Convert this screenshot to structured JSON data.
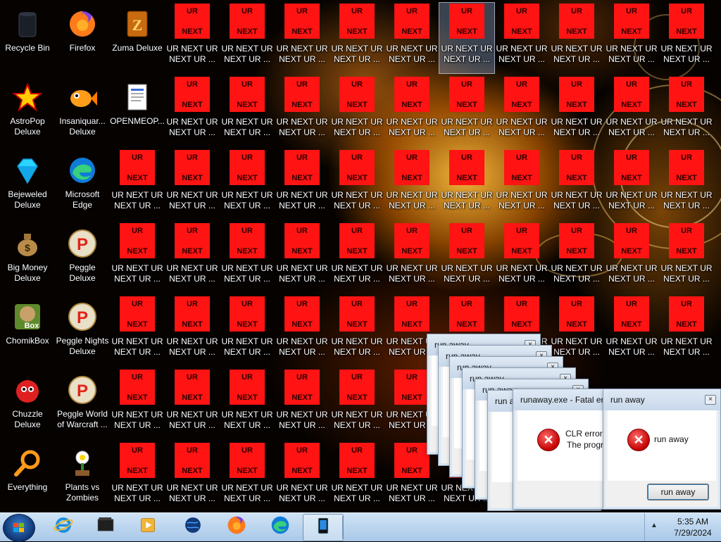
{
  "desktop_icons_left": [
    {
      "name": "recycle-bin",
      "icon": "recycle-bin-icon",
      "label": "Recycle Bin"
    },
    {
      "name": "firefox",
      "icon": "firefox-icon",
      "label": "Firefox"
    },
    {
      "name": "zuma-deluxe",
      "icon": "zuma-icon",
      "label": "Zuma Deluxe"
    },
    {
      "name": "astropop-deluxe",
      "icon": "astropop-icon",
      "label": "AstroPop\nDeluxe"
    },
    {
      "name": "insaniquarium-deluxe",
      "icon": "fish-icon",
      "label": "Insaniquar...\nDeluxe"
    },
    {
      "name": "openmeop",
      "icon": "document-icon",
      "label": "OPENMEOP..."
    },
    {
      "name": "bejeweled-deluxe",
      "icon": "gem-icon",
      "label": "Bejeweled\nDeluxe"
    },
    {
      "name": "microsoft-edge",
      "icon": "edge-icon",
      "label": "Microsoft\nEdge"
    },
    {
      "name": "big-money-deluxe",
      "icon": "money-bag-icon",
      "label": "Big Money\nDeluxe"
    },
    {
      "name": "peggle-deluxe",
      "icon": "peggle-icon",
      "label": "Peggle Deluxe"
    },
    {
      "name": "chomikbox",
      "icon": "chomikbox-icon",
      "label": "ChomikBox"
    },
    {
      "name": "peggle-nights-deluxe",
      "icon": "peggle-icon",
      "label": "Peggle Nights\nDeluxe"
    },
    {
      "name": "chuzzle-deluxe",
      "icon": "chuzzle-icon",
      "label": "Chuzzle\nDeluxe"
    },
    {
      "name": "peggle-world-of-warcraft",
      "icon": "peggle-icon",
      "label": "Peggle World\nof Warcraft ..."
    },
    {
      "name": "everything",
      "icon": "magnifier-icon",
      "label": "Everything"
    },
    {
      "name": "plants-vs-zombies",
      "icon": "plant-icon",
      "label": "Plants vs\nZombies"
    }
  ],
  "ur_next_icon": {
    "top_text": "UR",
    "bottom_text": "NEXT",
    "label": "UR NEXT UR\nNEXT UR ..."
  },
  "taskbar": {
    "pinned": [
      {
        "name": "internet-explorer",
        "icon": "ie-icon"
      },
      {
        "name": "file-explorer",
        "icon": "folder-icon"
      },
      {
        "name": "media-player",
        "icon": "media-player-icon"
      },
      {
        "name": "globe-app",
        "icon": "globe-icon"
      },
      {
        "name": "firefox",
        "icon": "firefox-icon"
      },
      {
        "name": "microsoft-edge",
        "icon": "edge-icon"
      },
      {
        "name": "runaway-app",
        "icon": "app-window-icon"
      }
    ],
    "time": "5:35 AM",
    "date": "7/29/2024"
  },
  "dialogs": {
    "stack_title": "run away",
    "fatal": {
      "title": "runaway.exe - Fatal error",
      "message_line1": "CLR error:",
      "message_line2": "The program"
    },
    "front": {
      "title": "run away",
      "message": "run away",
      "button": "run away"
    }
  },
  "colors": {
    "ur_icon_red": "#ff1313",
    "taskbar": "#bcd6f0"
  }
}
